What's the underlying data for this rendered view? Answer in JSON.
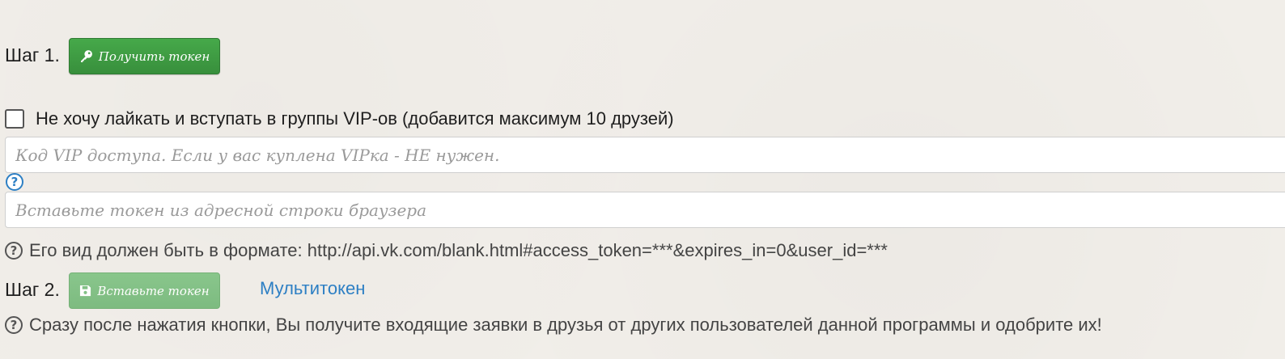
{
  "step1": {
    "label": "Шаг 1.",
    "button_label": "Получить токен",
    "button_icon": "key-icon"
  },
  "vip_checkbox": {
    "label": "Не хочу лайкать и вступать в группы VIP-ов (добавится максимум 10 друзей)",
    "checked": false
  },
  "vip_code_input": {
    "placeholder": "Код VIP доступа. Если у вас куплена VIPка - НЕ нужен.",
    "value": ""
  },
  "token_input": {
    "placeholder": "Вставьте токен из адресной строки браузера",
    "value": ""
  },
  "token_format_note": "Его вид должен быть в формате: http://api.vk.com/blank.html#access_token=***&expires_in=0&user_id=***",
  "step2": {
    "label": "Шаг 2.",
    "button_label": "Вставьте токен",
    "button_icon": "save-icon",
    "multitoken_link": "Мультитокен"
  },
  "step2_note": "Сразу после нажатия кнопки, Вы получите входящие заявки в друзья от других пользователей данной программы и одобрите их!",
  "colors": {
    "green": "#3f9c43",
    "green_disabled": "#7dbf80",
    "link_blue": "#2d7fc4"
  }
}
